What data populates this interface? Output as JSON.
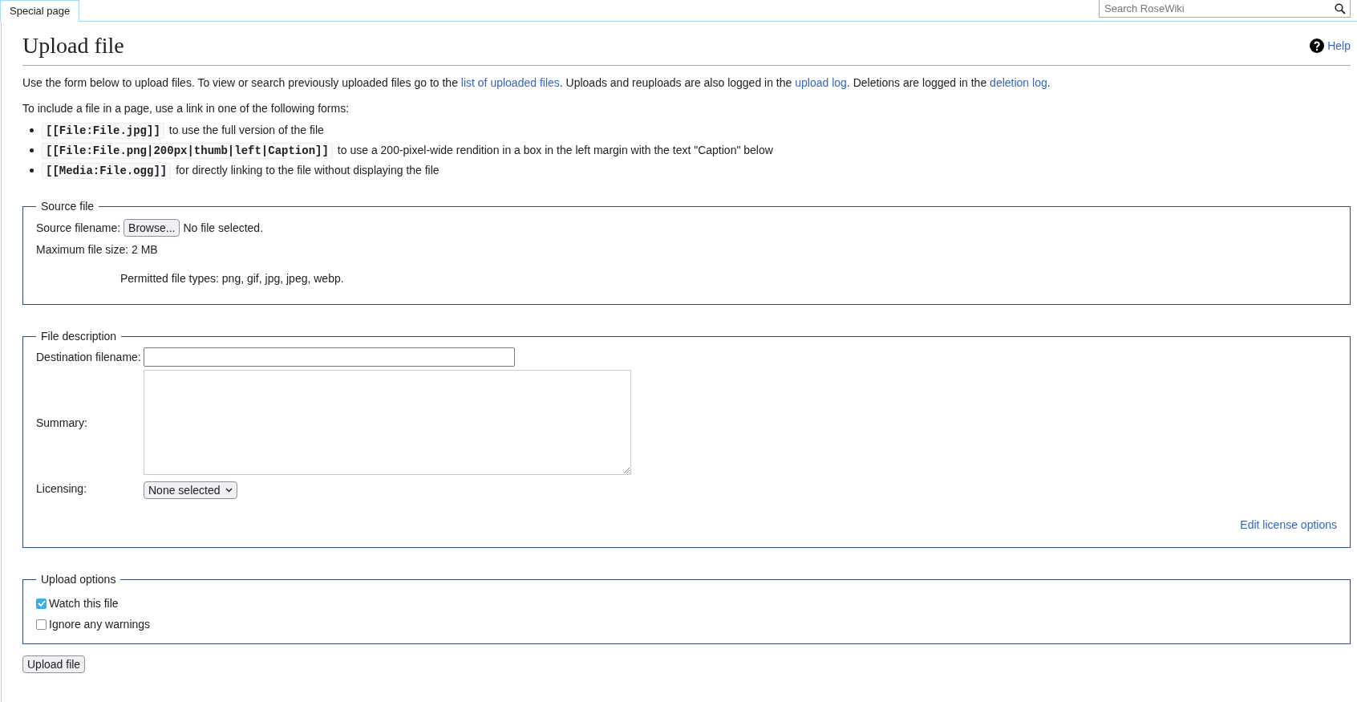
{
  "tabs": [
    {
      "label": "Special page",
      "selected": true
    }
  ],
  "search": {
    "placeholder": "Search RoseWiki"
  },
  "title": "Upload file",
  "help_link": "Help",
  "intro": [
    {
      "kind": "text",
      "text": "Use the form below to upload files. To view or search previously uploaded files go to the "
    },
    {
      "kind": "link",
      "text": "list of uploaded files"
    },
    {
      "kind": "text",
      "text": ". Uploads and reuploads are also logged in the "
    },
    {
      "kind": "link",
      "text": "upload log"
    },
    {
      "kind": "text",
      "text": ". Deletions are logged in the "
    },
    {
      "kind": "link",
      "text": "deletion log"
    },
    {
      "kind": "text",
      "text": "."
    }
  ],
  "forms_intro": "To include a file in a page, use a link in one of the following forms:",
  "forms": [
    {
      "code": "[[File:File.jpg]]",
      "text": "to use the full version of the file"
    },
    {
      "code": "[[File:File.png|200px|thumb|left|Caption]]",
      "text": "to use a 200-pixel-wide rendition in a box in the left margin with the text \"Caption\" below"
    },
    {
      "code": "[[Media:File.ogg]]",
      "text": "for directly linking to the file without displaying the file"
    }
  ],
  "source_file": {
    "legend": "Source file",
    "filename_label": "Source filename:",
    "browse_button": "Browse...",
    "file_status": "No file selected.",
    "max_size": "Maximum file size: 2 MB",
    "permitted_types": "Permitted file types: png, gif, jpg, jpeg, webp."
  },
  "file_description": {
    "legend": "File description",
    "destination_label": "Destination filename:",
    "summary_label": "Summary:",
    "licensing_label": "Licensing:",
    "licensing_value": "None selected",
    "edit_license_link": "Edit license options"
  },
  "upload_options": {
    "legend": "Upload options",
    "options": [
      {
        "label": "Watch this file",
        "checked": true
      },
      {
        "label": "Ignore any warnings",
        "checked": false
      }
    ]
  },
  "submit_button": "Upload file"
}
